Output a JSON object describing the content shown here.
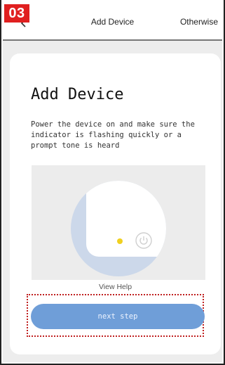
{
  "step_badge": "03",
  "header": {
    "title": "Add Device",
    "right_action": "Otherwise"
  },
  "card": {
    "title": "Add Device",
    "description": "Power the device on and make sure the indicator is flashing quickly or a prompt tone is heard",
    "view_help": "View Help",
    "next_button": "next step"
  },
  "colors": {
    "badge": "#e02020",
    "button": "#6f9ed8",
    "indicator": "#f0d020",
    "background": "#ededed"
  },
  "icons": {
    "back": "chevron-left-icon",
    "power": "power-icon"
  }
}
